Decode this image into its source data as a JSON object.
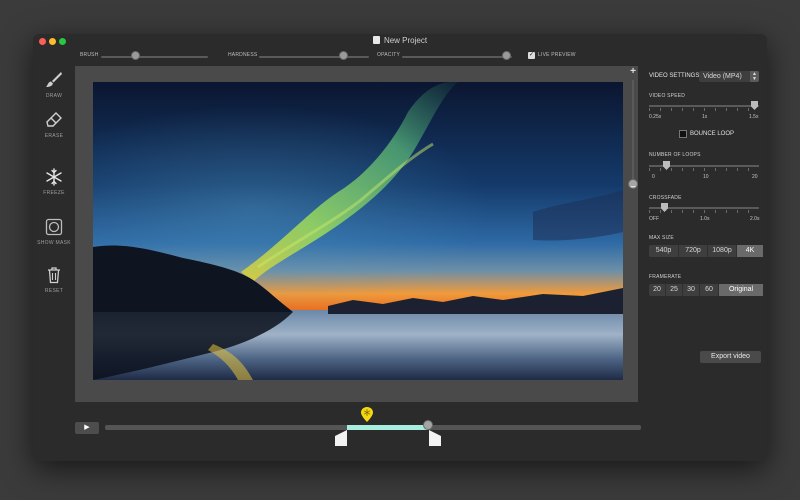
{
  "window": {
    "title": "New Project"
  },
  "toolbar": {
    "brush_label": "BRUSH",
    "hardness_label": "HARDNESS",
    "opacity_label": "OPACITY",
    "live_preview_label": "LIVE PREVIEW",
    "live_preview_checked": true
  },
  "tools": [
    {
      "label": "DRAW",
      "icon": "brush-icon"
    },
    {
      "label": "ERASE",
      "icon": "eraser-icon"
    },
    {
      "label": "FREEZE",
      "icon": "snowflake-icon"
    },
    {
      "label": "SHOW MASK",
      "icon": "mask-icon"
    },
    {
      "label": "RESET",
      "icon": "trash-icon"
    }
  ],
  "zoom": {
    "plus": "+",
    "minus": "−"
  },
  "timeline": {
    "play_icon": "▶"
  },
  "settings": {
    "title": "VIDEO SETTINGS",
    "format": "Video (MP4)",
    "video_speed_label": "VIDEO SPEED",
    "video_speed_ticks": [
      "0.25x",
      "1x",
      "1.5x"
    ],
    "bounce_loop_label": "BOUNCE LOOP",
    "bounce_loop_checked": false,
    "loops_label": "NUMBER OF LOOPS",
    "loops_ticks": [
      "0",
      "10",
      "20"
    ],
    "crossfade_label": "CROSSFADE",
    "crossfade_ticks": [
      "OFF",
      "1.0s",
      "2.0s"
    ],
    "max_size_label": "MAX SIZE",
    "max_size_options": [
      "540p",
      "720p",
      "1080p",
      "4K"
    ],
    "max_size_selected": "4K",
    "framerate_label": "FRAMERATE",
    "framerate_options": [
      "20",
      "25",
      "30",
      "60",
      "Original"
    ],
    "framerate_selected": "Original",
    "export_label": "Export video"
  },
  "colors": {
    "selection": "#a7eedf",
    "marker": "#f5d80f"
  }
}
